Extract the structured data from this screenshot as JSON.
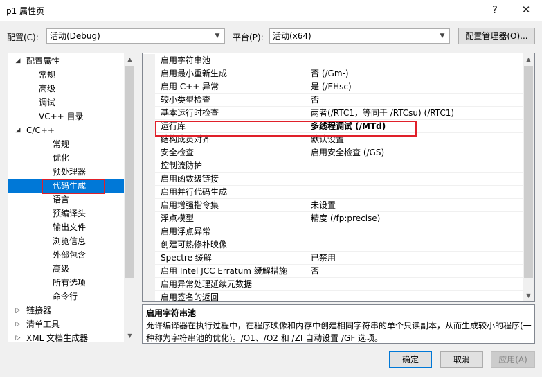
{
  "window": {
    "title": "p1 属性页",
    "help_glyph": "?",
    "close_glyph": "✕"
  },
  "config_bar": {
    "config_label": "配置(C):",
    "config_value": "活动(Debug)",
    "platform_label": "平台(P):",
    "platform_value": "活动(x64)",
    "config_manager_label": "配置管理器(O)..."
  },
  "tree": {
    "items": [
      {
        "label": "配置属性",
        "expander": "◢"
      },
      {
        "label": "常规"
      },
      {
        "label": "高级"
      },
      {
        "label": "调试"
      },
      {
        "label": "VC++ 目录"
      },
      {
        "label": "C/C++",
        "expander": "◢"
      },
      {
        "label": "常规"
      },
      {
        "label": "优化"
      },
      {
        "label": "预处理器"
      },
      {
        "label": "代码生成",
        "selected": true
      },
      {
        "label": "语言"
      },
      {
        "label": "预编译头"
      },
      {
        "label": "输出文件"
      },
      {
        "label": "浏览信息"
      },
      {
        "label": "外部包含"
      },
      {
        "label": "高级"
      },
      {
        "label": "所有选项"
      },
      {
        "label": "命令行"
      },
      {
        "label": "链接器",
        "expander": "▷"
      },
      {
        "label": "清单工具",
        "expander": "▷"
      },
      {
        "label": "XML 文档生成器",
        "expander": "▷"
      }
    ]
  },
  "properties": [
    {
      "name": "启用字符串池",
      "value": ""
    },
    {
      "name": "启用最小重新生成",
      "value": "否 (/Gm-)"
    },
    {
      "name": "启用 C++ 异常",
      "value": "是 (/EHsc)"
    },
    {
      "name": "较小类型检查",
      "value": "否"
    },
    {
      "name": "基本运行时检查",
      "value": "两者(/RTC1，等同于 /RTCsu) (/RTC1)"
    },
    {
      "name": "运行库",
      "value": "多线程调试 (/MTd)",
      "bold": true
    },
    {
      "name": "结构成员对齐",
      "value": "默认设置"
    },
    {
      "name": "安全检查",
      "value": "启用安全检查 (/GS)"
    },
    {
      "name": "控制流防护",
      "value": ""
    },
    {
      "name": "启用函数级链接",
      "value": ""
    },
    {
      "name": "启用并行代码生成",
      "value": ""
    },
    {
      "name": "启用增强指令集",
      "value": "未设置"
    },
    {
      "name": "浮点模型",
      "value": "精度 (/fp:precise)"
    },
    {
      "name": "启用浮点异常",
      "value": ""
    },
    {
      "name": "创建可热修补映像",
      "value": ""
    },
    {
      "name": "Spectre 缓解",
      "value": "已禁用"
    },
    {
      "name": "启用 Intel JCC Erratum 缓解措施",
      "value": "否"
    },
    {
      "name": "启用异常处理延续元数据",
      "value": ""
    },
    {
      "name": "启用签名的返回",
      "value": ""
    }
  ],
  "description": {
    "title": "启用字符串池",
    "text": "允许编译器在执行过程中，在程序映像和内存中创建相同字符串的单个只读副本，从而生成较小的程序(一种称为字符串池的优化)。/O1、/O2 和 /ZI 自动设置 /GF 选项。"
  },
  "buttons": {
    "ok": "确定",
    "cancel": "取消",
    "apply": "应用(A)"
  },
  "colors": {
    "selection": "#0078d7",
    "highlight_box": "#e0202a"
  }
}
